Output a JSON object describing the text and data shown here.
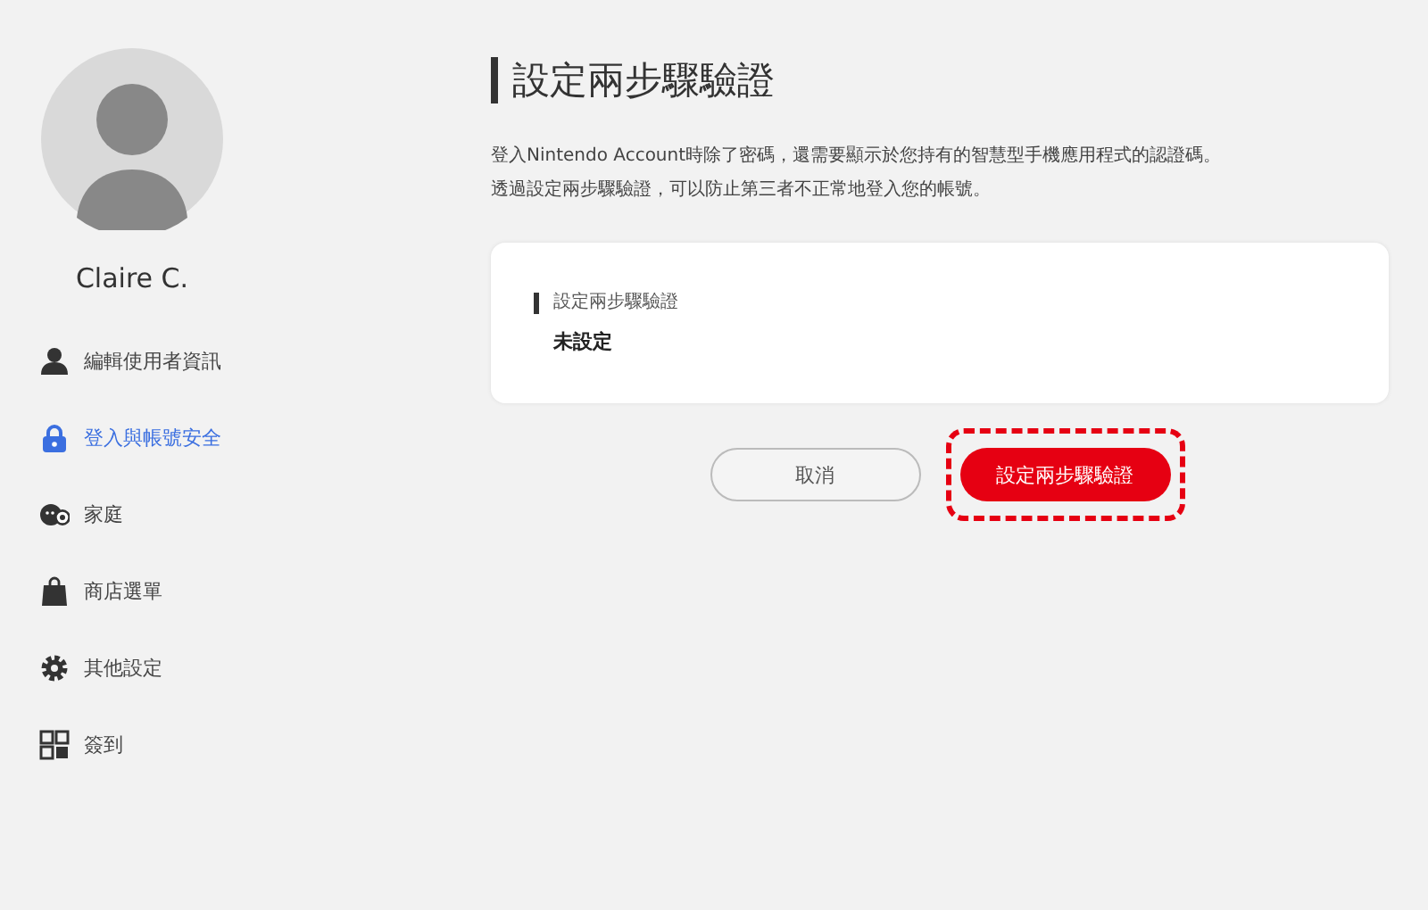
{
  "user": {
    "name": "Claire C."
  },
  "sidebar": {
    "items": [
      {
        "label": "編輯使用者資訊",
        "selected": false
      },
      {
        "label": "登入與帳號安全",
        "selected": true
      },
      {
        "label": "家庭",
        "selected": false
      },
      {
        "label": "商店選單",
        "selected": false
      },
      {
        "label": "其他設定",
        "selected": false
      },
      {
        "label": "簽到",
        "selected": false
      }
    ]
  },
  "page": {
    "title": "設定兩步驟驗證",
    "description": [
      "登入Nintendo Account時除了密碼，還需要顯示於您持有的智慧型手機應用程式的認證碼。",
      "透過設定兩步驟驗證，可以防止第三者不正常地登入您的帳號。"
    ]
  },
  "card": {
    "label": "設定兩步驟驗證",
    "value": "未設定"
  },
  "buttons": [
    {
      "kind": "secondary",
      "label": "取消",
      "highlighted": false
    },
    {
      "kind": "primary",
      "label": "設定兩步驟驗證",
      "highlighted": true
    }
  ]
}
